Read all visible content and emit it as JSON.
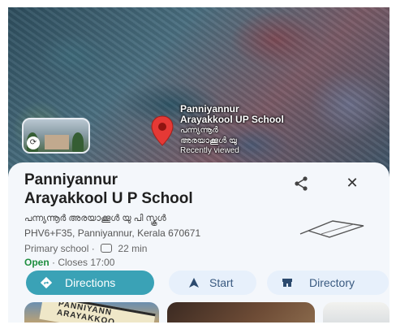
{
  "map": {
    "pin_name_line1": "Panniyannur",
    "pin_name_line2": "Arayakkool UP School",
    "pin_malayalam_line1": "പന്ന്യന്നൂർ",
    "pin_malayalam_line2": "അരയാക്കൂൾ യു",
    "pin_status": "Recently viewed",
    "accent_pin_color": "#e53935"
  },
  "place": {
    "title_line1": "Panniyannur",
    "title_line2": "Arayakkool U P School",
    "malayalam_name": "പന്ന്യന്നൂർ അരയാക്കൂൾ യു പി സ്കൂൾ",
    "address": "PHV6+F35, Panniyannur, Kerala 670671",
    "category": "Primary school",
    "separator": "·",
    "drive_time": "22 min",
    "open_status": "Open",
    "hours": "· Closes 17:00"
  },
  "actions": {
    "directions": "Directions",
    "start": "Start",
    "directory": "Directory"
  },
  "photos": {
    "sign_text_line1": "PANNIYANN",
    "sign_text_line2": "ARAYAKKOO"
  },
  "colors": {
    "primary_button": "#3aa2b6",
    "secondary_button": "#e7f0fb",
    "open_green": "#1e8e3e"
  }
}
